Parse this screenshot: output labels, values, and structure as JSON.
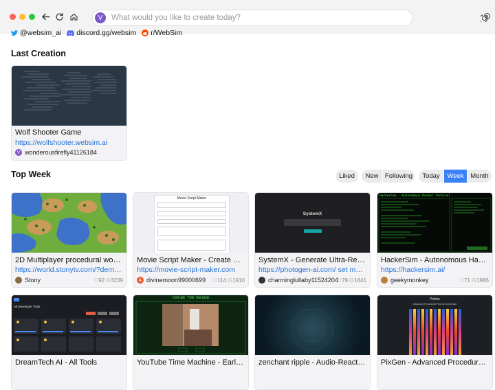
{
  "toolbar": {
    "address_avatar": "V",
    "address_placeholder": "What would you like to create today?"
  },
  "social_links": [
    {
      "icon": "twitter-icon",
      "label": "@websim_ai"
    },
    {
      "icon": "discord-icon",
      "label": "discord.gg/websim"
    },
    {
      "icon": "reddit-icon",
      "label": "r/WebSim"
    }
  ],
  "last_creation": {
    "heading": "Last Creation",
    "card": {
      "title": "Wolf Shooter Game",
      "url": "https://wolfshooter.websim.ai",
      "author_initial": "V",
      "author": "wonderousfirefly41126184"
    }
  },
  "top_week": {
    "heading": "Top Week",
    "filters_left": [
      "Liked",
      "New",
      "Following"
    ],
    "filters_right": [
      "Today",
      "Week",
      "Month"
    ],
    "active_filter": "Week",
    "cards": [
      {
        "title": "2D Multiplayer procedural world...",
        "url": "https://world.stonytv.com/?demo=true",
        "author": "Stony",
        "likes": "92",
        "views": "3239"
      },
      {
        "title": "Movie Script Maker - Create Yo...",
        "url": "https://movie-script-maker.com",
        "author_initial": "A",
        "author": "divinemoon99000699",
        "likes": "114",
        "views": "1910"
      },
      {
        "title": "SystemX - Generate Ultra-Reali...",
        "url": "https://photogen-ai.com/ set max-width:",
        "author": "charminglullaby11524204",
        "likes": "79",
        "views": "1841"
      },
      {
        "title": "HackerSim - Autonomous Hack...",
        "url": "https://hackersim.ai/",
        "author": "geekymonkey",
        "likes": "71",
        "views": "1986"
      },
      {
        "title": "DreamTech AI - All Tools"
      },
      {
        "title": "YouTube Time Machine - Early..."
      },
      {
        "title": "zenchant ripple - Audio-Reactiv..."
      },
      {
        "title": "PixGen - Advanced Procedural..."
      }
    ],
    "thumb_text": {
      "movie_heading": "Movie Script Maker",
      "systemx_heading": "SystemX",
      "hacker_heading": "HackerSim - Autonomous Hacker Terminal",
      "dreamtech_heading": "All Developer Tools",
      "youtube_heading": "YOUTUBE TIME MACHINE",
      "pixgen_heading": "Pixtles",
      "pixgen_sub": "Advanced Procedural Pixel Art Generator"
    }
  },
  "colors": {
    "accent": "#3b82f6",
    "link": "#1f6fd6",
    "avatar_purple": "#7b58c8"
  }
}
